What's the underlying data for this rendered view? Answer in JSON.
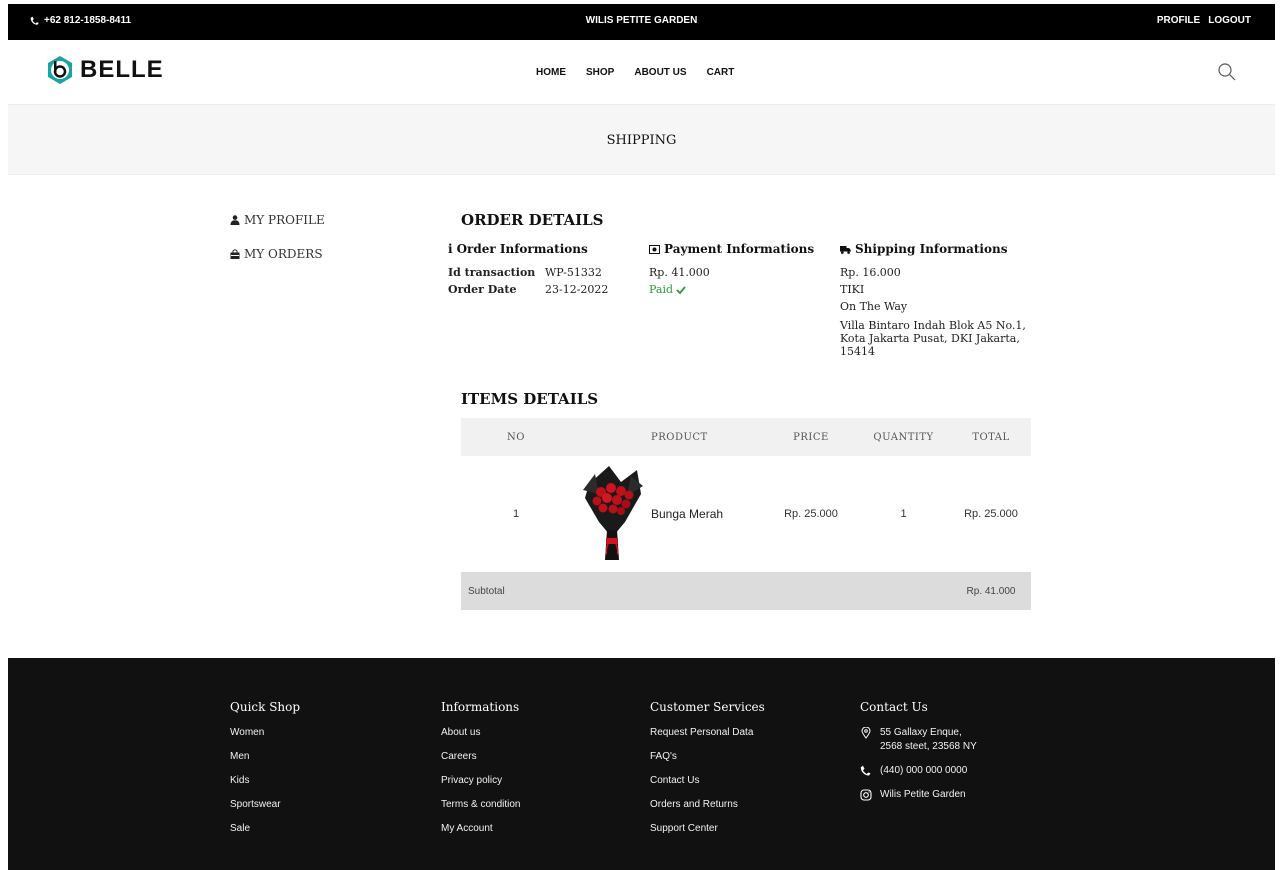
{
  "topbar": {
    "phone": "+62 812-1858-8411",
    "store_name": "WILIS PETITE GARDEN",
    "profile_link": "PROFILE",
    "logout_link": "LOGOUT"
  },
  "header": {
    "logo_text": "BELLE",
    "nav": [
      {
        "label": "HOME"
      },
      {
        "label": "SHOP"
      },
      {
        "label": "ABOUT US"
      },
      {
        "label": "CART"
      }
    ]
  },
  "banner": {
    "title": "SHIPPING"
  },
  "sidebar": {
    "items": [
      {
        "label": "MY PROFILE"
      },
      {
        "label": "MY ORDERS"
      }
    ]
  },
  "order": {
    "heading": "ORDER DETAILS",
    "order_info": {
      "title": "Order Informations",
      "id_label": "Id transaction",
      "id_value": "WP-51332",
      "date_label": "Order Date",
      "date_value": "23-12-2022"
    },
    "payment_info": {
      "title": "Payment Informations",
      "amount": "Rp. 41.000",
      "status": "Paid"
    },
    "shipping_info": {
      "title": "Shipping Informations",
      "cost": "Rp. 16.000",
      "courier": "TIKI",
      "status": "On The Way",
      "address": "Villa Bintaro Indah Blok A5 No.1, Kota Jakarta Pusat, DKI Jakarta, 15414"
    }
  },
  "items": {
    "heading": "ITEMS DETAILS",
    "columns": {
      "no": "NO",
      "product": "PRODUCT",
      "price": "PRICE",
      "quantity": "QUANTITY",
      "total": "TOTAL"
    },
    "rows": [
      {
        "no": "1",
        "product": "Bunga Merah",
        "price": "Rp. 25.000",
        "quantity": "1",
        "total": "Rp. 25.000"
      }
    ],
    "subtotal_label": "Subtotal",
    "subtotal_value": "Rp. 41.000"
  },
  "footer": {
    "quick_shop": {
      "title": "Quick Shop",
      "links": [
        "Women",
        "Men",
        "Kids",
        "Sportswear",
        "Sale"
      ]
    },
    "informations": {
      "title": "Informations",
      "links": [
        "About us",
        "Careers",
        "Privacy policy",
        "Terms & condition",
        "My Account"
      ]
    },
    "customer_services": {
      "title": "Customer Services",
      "links": [
        "Request Personal Data",
        "FAQ's",
        "Contact Us",
        "Orders and Returns",
        "Support Center"
      ]
    },
    "contact": {
      "title": "Contact Us",
      "address_line1": "55 Gallaxy Enque,",
      "address_line2": "2568 steet, 23568 NY",
      "phone": "(440) 000 000 0000",
      "instagram": "Wilis Petite Garden"
    }
  },
  "colors": {
    "topbar_bg": "#000000",
    "footer_bg": "#111111",
    "paid_green": "#2a9d3b",
    "logo_teal": "#1aa3a3"
  }
}
